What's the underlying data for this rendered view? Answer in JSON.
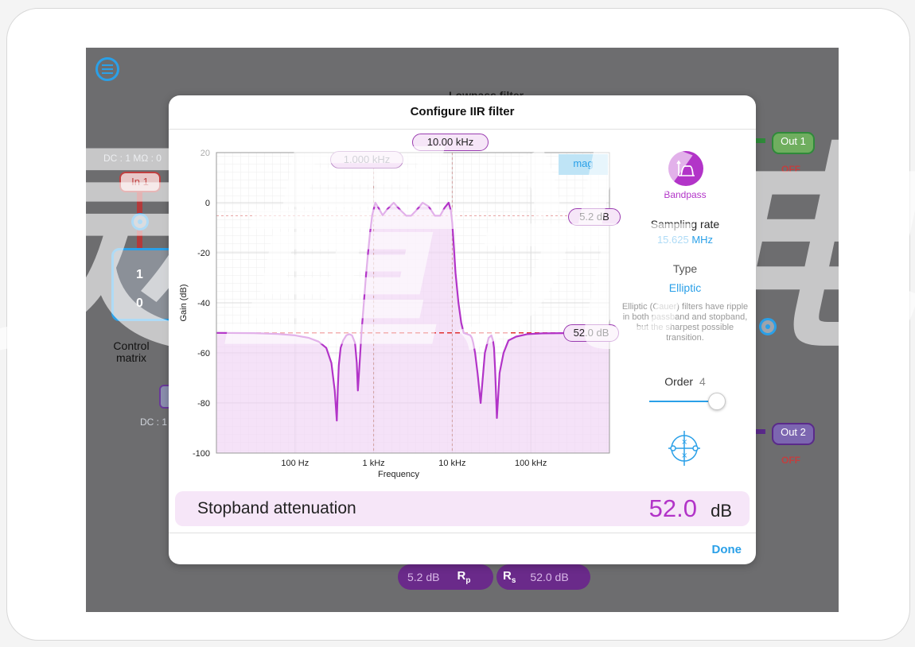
{
  "modal": {
    "title": "Configure IIR filter",
    "done_label": "Done"
  },
  "chart_data": {
    "type": "line",
    "xlabel": "Frequency",
    "ylabel": "Gain (dB)",
    "x_scale": "log",
    "xlim": [
      10,
      1000000
    ],
    "ylim": [
      -100,
      20
    ],
    "x_ticks": [
      {
        "value": 100,
        "label": "100 Hz"
      },
      {
        "value": 1000,
        "label": "1 kHz"
      },
      {
        "value": 10000,
        "label": "10 kHz"
      },
      {
        "value": 100000,
        "label": "100 kHz"
      }
    ],
    "y_ticks": [
      20,
      0,
      -20,
      -40,
      -60,
      -80,
      -100
    ],
    "grid": true,
    "series": [
      {
        "x": [
          10,
          30,
          60,
          100,
          150,
          200,
          250,
          290,
          320,
          340,
          350,
          360,
          380,
          410,
          450,
          490,
          530,
          580,
          610,
          630,
          660,
          700,
          750,
          800,
          850,
          900,
          960,
          1050,
          1150,
          1300,
          1500,
          1800,
          2200,
          2600,
          3000,
          3500,
          4200,
          5000,
          6000,
          7000,
          8000,
          9000,
          9600,
          10000,
          10500,
          11000,
          12000,
          13000,
          14000,
          15500,
          17000,
          17800,
          18500,
          19500,
          21000,
          23000,
          26000,
          29000,
          31500,
          33000,
          34000,
          35000,
          37000,
          40000,
          45000,
          52000,
          65000,
          90000,
          140000,
          250000,
          500000,
          1000000
        ],
        "y": [
          -52,
          -52.1,
          -52.4,
          -53,
          -54,
          -55.5,
          -58,
          -64,
          -75,
          -87,
          -74,
          -65,
          -58,
          -55,
          -53,
          -52.5,
          -53,
          -56,
          -64,
          -75,
          -65,
          -52,
          -40,
          -29,
          -20,
          -12,
          -5,
          0,
          -2,
          -5,
          -2.5,
          0,
          -3,
          -5.2,
          -5.2,
          -3,
          0,
          -1.5,
          -5.2,
          -5.2,
          -2,
          0,
          -3,
          -8,
          -18,
          -28,
          -40,
          -48,
          -52,
          -52.5,
          -53,
          -54,
          -56,
          -60,
          -68,
          -80,
          -60,
          -54,
          -53,
          -55,
          -58,
          -66,
          -86,
          -68,
          -60,
          -55,
          -53.5,
          -52.5,
          -52.2,
          -52.1,
          -52,
          -52
        ]
      }
    ],
    "reference_lines": [
      {
        "axis": "x",
        "value": 1000,
        "label": "1.000 kHz"
      },
      {
        "axis": "x",
        "value": 10000,
        "label": "10.00 kHz"
      },
      {
        "axis": "y",
        "value": -5.2,
        "label": "5.2 dB"
      },
      {
        "axis": "y",
        "value": -52,
        "label": "52.0 dB"
      }
    ],
    "view_tab": "mag"
  },
  "side": {
    "mode_label": "Bandpass",
    "sampling_key": "Sampling rate",
    "sampling_value": "15.625 MHz",
    "type_key": "Type",
    "type_value": "Elliptic",
    "type_desc": "Elliptic (Cauer) filters have ripple in both passband and stopband, but the sharpest possible transition.",
    "order_key": "Order",
    "order_value": "4",
    "order_level": 0.95
  },
  "parameter": {
    "label": "Stopband attenuation",
    "value": "52.0",
    "unit": "dB"
  },
  "background": {
    "top_label": "Lowpass filter",
    "dc_left": "DC : 1 MΩ : 0",
    "dc_left2": "DC : 1",
    "in_label": "In 1",
    "out1_label": "Out 1",
    "out2_label": "Out 2",
    "off_label": "OFF",
    "matrix_cell_top": "1",
    "matrix_cell_bottom": "0",
    "matrix_label": "Control matrix",
    "rp_value": "5.2 dB",
    "rp_symbol": "R",
    "rp_sub": "p",
    "rs_symbol": "R",
    "rs_sub": "s",
    "rs_value": "52.0 dB"
  },
  "watermark": "灵量光电",
  "colors": {
    "accent": "#2aa0e8",
    "curve": "#b234c8",
    "fill": "#f0d3f5",
    "stopband_line": "#e03030"
  }
}
